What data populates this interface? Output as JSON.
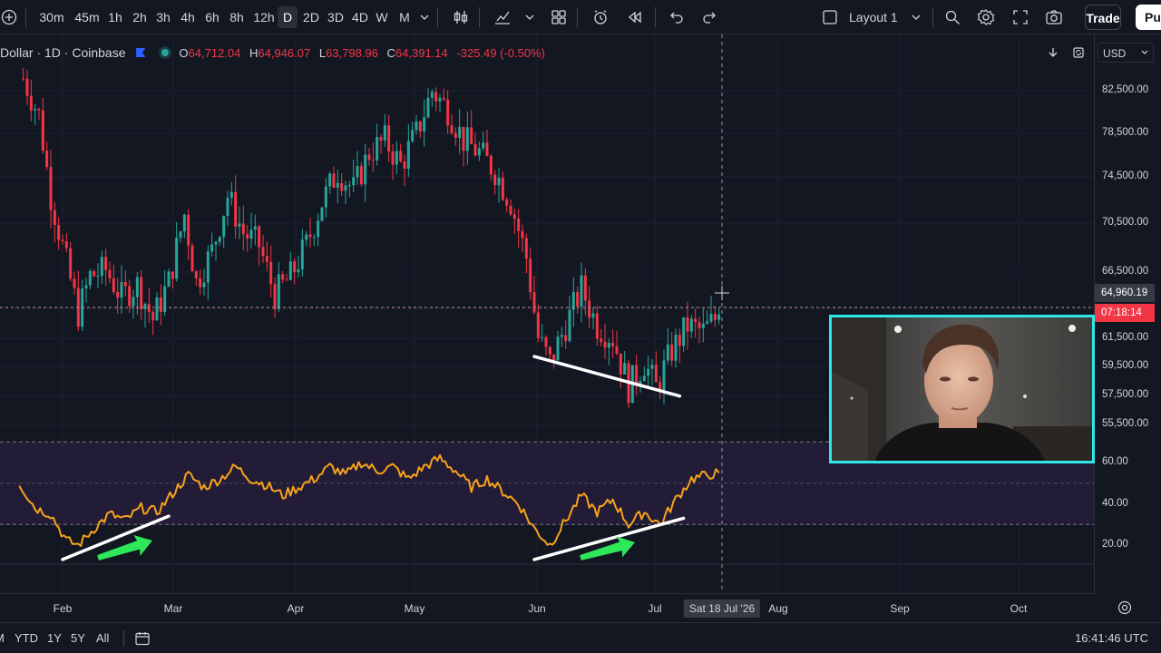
{
  "toolbar": {
    "intervals": [
      "30m",
      "45m",
      "1h",
      "2h",
      "3h",
      "4h",
      "6h",
      "8h",
      "12h",
      "D",
      "2D",
      "3D",
      "4D",
      "W",
      "M"
    ],
    "active_interval": "D",
    "layout_label": "Layout 1",
    "trade_label": "Trade",
    "publish_label": "Pu"
  },
  "symbol": {
    "title": "Dollar · 1D · Coinbase",
    "open_label": "O",
    "open": "64,712.04",
    "high_label": "H",
    "high": "64,946.07",
    "low_label": "L",
    "low": "63,798.96",
    "close_label": "C",
    "close": "64,391.14",
    "change": "-325.49 (-0.50%)"
  },
  "currency": "USD",
  "price_axis": {
    "labels": [
      "82,500.00",
      "78,500.00",
      "74,500.00",
      "70,500.00",
      "66,500.00",
      "61,500.00",
      "59,500.00",
      "57,500.00",
      "55,500.00"
    ],
    "current_price": "64,960.19",
    "countdown": "07:18:14"
  },
  "rsi_axis": {
    "labels": [
      "60.00",
      "40.00",
      "20.00"
    ]
  },
  "time_axis": {
    "labels": [
      "Feb",
      "Mar",
      "Apr",
      "May",
      "Jun",
      "Jul",
      "Aug",
      "Sep",
      "Oct"
    ],
    "crosshair_label": "Sat 18 Jul '26"
  },
  "bottom": {
    "ranges": [
      "M",
      "YTD",
      "1Y",
      "5Y",
      "All"
    ],
    "clock": "16:41:46 UTC"
  },
  "colors": {
    "up": "#26a69a",
    "down": "#f23645",
    "rsi_line": "#f7a21b",
    "rsi_band": "#2a1f3d",
    "webcam_border": "#2ee8e8",
    "annotation_arrow": "#2ee85a"
  },
  "icons": [
    "add-icon",
    "chevron-down-icon",
    "bar-style-icon",
    "indicators-icon",
    "templates-icon",
    "alert-icon",
    "replay-icon",
    "undo-icon",
    "redo-icon",
    "layout-icon",
    "search-icon",
    "settings-icon",
    "fullscreen-icon",
    "camera-icon",
    "download-icon",
    "refresh-icon",
    "settings-gear-icon",
    "calendar-icon"
  ],
  "chart_data": {
    "type": "candlestick",
    "title": "Dollar · 1D · Coinbase",
    "ylim": [
      51500,
      86500
    ],
    "x_range": [
      "2026-01-21",
      "2026-10-26"
    ],
    "candles_close_path": [
      [
        "2026-01-22",
        83500
      ],
      [
        "2026-01-26",
        80500
      ],
      [
        "2026-01-29",
        74000
      ],
      [
        "2026-02-02",
        68500
      ],
      [
        "2026-02-05",
        64500
      ],
      [
        "2026-02-08",
        67500
      ],
      [
        "2026-02-12",
        68000
      ],
      [
        "2026-02-16",
        65800
      ],
      [
        "2026-02-20",
        66800
      ],
      [
        "2026-02-24",
        64000
      ],
      [
        "2026-02-28",
        67000
      ],
      [
        "2026-03-04",
        72500
      ],
      [
        "2026-03-07",
        67000
      ],
      [
        "2026-03-11",
        69500
      ],
      [
        "2026-03-15",
        74000
      ],
      [
        "2026-03-19",
        71000
      ],
      [
        "2026-03-23",
        70000
      ],
      [
        "2026-03-27",
        66000
      ],
      [
        "2026-03-31",
        67500
      ],
      [
        "2026-04-04",
        70000
      ],
      [
        "2026-04-08",
        73500
      ],
      [
        "2026-04-12",
        76000
      ],
      [
        "2026-04-16",
        74500
      ],
      [
        "2026-04-20",
        77500
      ],
      [
        "2026-04-24",
        78500
      ],
      [
        "2026-04-28",
        76500
      ],
      [
        "2026-05-02",
        79000
      ],
      [
        "2026-05-06",
        82500
      ],
      [
        "2026-05-10",
        81000
      ],
      [
        "2026-05-14",
        78500
      ],
      [
        "2026-05-18",
        77500
      ],
      [
        "2026-05-22",
        76000
      ],
      [
        "2026-05-26",
        73500
      ],
      [
        "2026-05-30",
        69000
      ],
      [
        "2026-06-02",
        62500
      ],
      [
        "2026-06-05",
        60500
      ],
      [
        "2026-06-09",
        63500
      ],
      [
        "2026-06-13",
        66500
      ],
      [
        "2026-06-17",
        63500
      ],
      [
        "2026-06-21",
        62500
      ],
      [
        "2026-06-25",
        58500
      ],
      [
        "2026-06-29",
        60500
      ],
      [
        "2026-07-02",
        58500
      ],
      [
        "2026-07-06",
        61500
      ],
      [
        "2026-07-10",
        63500
      ],
      [
        "2026-07-14",
        63000
      ],
      [
        "2026-07-18",
        64391
      ]
    ],
    "last_close": 64391.14,
    "current_price_line": 64960.19,
    "rsi": {
      "ylim": [
        10,
        70
      ],
      "levels": [
        70,
        30
      ],
      "labels": [
        60,
        40,
        20
      ],
      "path": [
        [
          "2026-01-21",
          50
        ],
        [
          "2026-01-25",
          38
        ],
        [
          "2026-01-29",
          35
        ],
        [
          "2026-02-02",
          22
        ],
        [
          "2026-02-05",
          20
        ],
        [
          "2026-02-09",
          28
        ],
        [
          "2026-02-13",
          35
        ],
        [
          "2026-02-17",
          32
        ],
        [
          "2026-02-21",
          38
        ],
        [
          "2026-02-25",
          36
        ],
        [
          "2026-03-01",
          45
        ],
        [
          "2026-03-05",
          54
        ],
        [
          "2026-03-09",
          48
        ],
        [
          "2026-03-13",
          52
        ],
        [
          "2026-03-17",
          58
        ],
        [
          "2026-03-21",
          52
        ],
        [
          "2026-03-25",
          49
        ],
        [
          "2026-03-29",
          44
        ],
        [
          "2026-04-02",
          48
        ],
        [
          "2026-04-06",
          52
        ],
        [
          "2026-04-10",
          58
        ],
        [
          "2026-04-14",
          54
        ],
        [
          "2026-04-18",
          60
        ],
        [
          "2026-04-22",
          56
        ],
        [
          "2026-04-26",
          58
        ],
        [
          "2026-04-30",
          52
        ],
        [
          "2026-05-04",
          58
        ],
        [
          "2026-05-08",
          62
        ],
        [
          "2026-05-12",
          56
        ],
        [
          "2026-05-16",
          48
        ],
        [
          "2026-05-20",
          52
        ],
        [
          "2026-05-24",
          46
        ],
        [
          "2026-05-28",
          40
        ],
        [
          "2026-06-01",
          28
        ],
        [
          "2026-06-05",
          20
        ],
        [
          "2026-06-09",
          32
        ],
        [
          "2026-06-13",
          44
        ],
        [
          "2026-06-17",
          36
        ],
        [
          "2026-06-21",
          42
        ],
        [
          "2026-06-25",
          30
        ],
        [
          "2026-06-29",
          36
        ],
        [
          "2026-07-03",
          30
        ],
        [
          "2026-07-07",
          42
        ],
        [
          "2026-07-11",
          52
        ],
        [
          "2026-07-15",
          54
        ],
        [
          "2026-07-18",
          55
        ]
      ]
    },
    "annotations": [
      {
        "type": "trendline",
        "pane": "price",
        "from": [
          "2026-06-01",
          61000
        ],
        "to": [
          "2026-07-08",
          57800
        ]
      },
      {
        "type": "trendline",
        "pane": "rsi",
        "from": [
          "2026-02-01",
          13
        ],
        "to": [
          "2026-02-28",
          34
        ]
      },
      {
        "type": "trendline",
        "pane": "rsi",
        "from": [
          "2026-06-01",
          13
        ],
        "to": [
          "2026-07-09",
          33
        ]
      }
    ]
  }
}
